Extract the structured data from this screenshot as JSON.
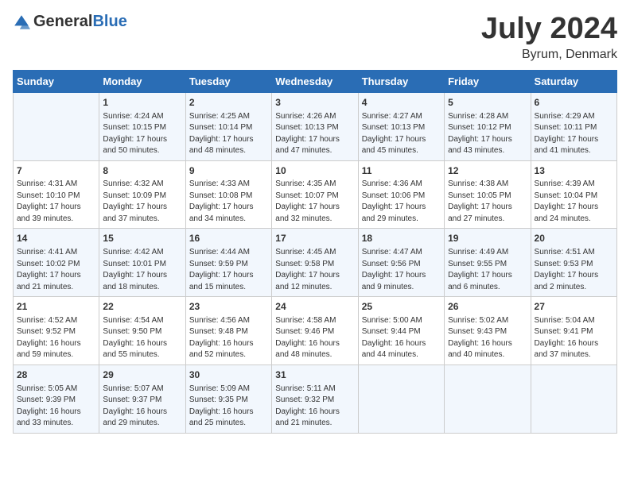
{
  "header": {
    "logo_general": "General",
    "logo_blue": "Blue",
    "month_title": "July 2024",
    "location": "Byrum, Denmark"
  },
  "days_of_week": [
    "Sunday",
    "Monday",
    "Tuesday",
    "Wednesday",
    "Thursday",
    "Friday",
    "Saturday"
  ],
  "weeks": [
    [
      {
        "day": "",
        "info": ""
      },
      {
        "day": "1",
        "info": "Sunrise: 4:24 AM\nSunset: 10:15 PM\nDaylight: 17 hours\nand 50 minutes."
      },
      {
        "day": "2",
        "info": "Sunrise: 4:25 AM\nSunset: 10:14 PM\nDaylight: 17 hours\nand 48 minutes."
      },
      {
        "day": "3",
        "info": "Sunrise: 4:26 AM\nSunset: 10:13 PM\nDaylight: 17 hours\nand 47 minutes."
      },
      {
        "day": "4",
        "info": "Sunrise: 4:27 AM\nSunset: 10:13 PM\nDaylight: 17 hours\nand 45 minutes."
      },
      {
        "day": "5",
        "info": "Sunrise: 4:28 AM\nSunset: 10:12 PM\nDaylight: 17 hours\nand 43 minutes."
      },
      {
        "day": "6",
        "info": "Sunrise: 4:29 AM\nSunset: 10:11 PM\nDaylight: 17 hours\nand 41 minutes."
      }
    ],
    [
      {
        "day": "7",
        "info": "Sunrise: 4:31 AM\nSunset: 10:10 PM\nDaylight: 17 hours\nand 39 minutes."
      },
      {
        "day": "8",
        "info": "Sunrise: 4:32 AM\nSunset: 10:09 PM\nDaylight: 17 hours\nand 37 minutes."
      },
      {
        "day": "9",
        "info": "Sunrise: 4:33 AM\nSunset: 10:08 PM\nDaylight: 17 hours\nand 34 minutes."
      },
      {
        "day": "10",
        "info": "Sunrise: 4:35 AM\nSunset: 10:07 PM\nDaylight: 17 hours\nand 32 minutes."
      },
      {
        "day": "11",
        "info": "Sunrise: 4:36 AM\nSunset: 10:06 PM\nDaylight: 17 hours\nand 29 minutes."
      },
      {
        "day": "12",
        "info": "Sunrise: 4:38 AM\nSunset: 10:05 PM\nDaylight: 17 hours\nand 27 minutes."
      },
      {
        "day": "13",
        "info": "Sunrise: 4:39 AM\nSunset: 10:04 PM\nDaylight: 17 hours\nand 24 minutes."
      }
    ],
    [
      {
        "day": "14",
        "info": "Sunrise: 4:41 AM\nSunset: 10:02 PM\nDaylight: 17 hours\nand 21 minutes."
      },
      {
        "day": "15",
        "info": "Sunrise: 4:42 AM\nSunset: 10:01 PM\nDaylight: 17 hours\nand 18 minutes."
      },
      {
        "day": "16",
        "info": "Sunrise: 4:44 AM\nSunset: 9:59 PM\nDaylight: 17 hours\nand 15 minutes."
      },
      {
        "day": "17",
        "info": "Sunrise: 4:45 AM\nSunset: 9:58 PM\nDaylight: 17 hours\nand 12 minutes."
      },
      {
        "day": "18",
        "info": "Sunrise: 4:47 AM\nSunset: 9:56 PM\nDaylight: 17 hours\nand 9 minutes."
      },
      {
        "day": "19",
        "info": "Sunrise: 4:49 AM\nSunset: 9:55 PM\nDaylight: 17 hours\nand 6 minutes."
      },
      {
        "day": "20",
        "info": "Sunrise: 4:51 AM\nSunset: 9:53 PM\nDaylight: 17 hours\nand 2 minutes."
      }
    ],
    [
      {
        "day": "21",
        "info": "Sunrise: 4:52 AM\nSunset: 9:52 PM\nDaylight: 16 hours\nand 59 minutes."
      },
      {
        "day": "22",
        "info": "Sunrise: 4:54 AM\nSunset: 9:50 PM\nDaylight: 16 hours\nand 55 minutes."
      },
      {
        "day": "23",
        "info": "Sunrise: 4:56 AM\nSunset: 9:48 PM\nDaylight: 16 hours\nand 52 minutes."
      },
      {
        "day": "24",
        "info": "Sunrise: 4:58 AM\nSunset: 9:46 PM\nDaylight: 16 hours\nand 48 minutes."
      },
      {
        "day": "25",
        "info": "Sunrise: 5:00 AM\nSunset: 9:44 PM\nDaylight: 16 hours\nand 44 minutes."
      },
      {
        "day": "26",
        "info": "Sunrise: 5:02 AM\nSunset: 9:43 PM\nDaylight: 16 hours\nand 40 minutes."
      },
      {
        "day": "27",
        "info": "Sunrise: 5:04 AM\nSunset: 9:41 PM\nDaylight: 16 hours\nand 37 minutes."
      }
    ],
    [
      {
        "day": "28",
        "info": "Sunrise: 5:05 AM\nSunset: 9:39 PM\nDaylight: 16 hours\nand 33 minutes."
      },
      {
        "day": "29",
        "info": "Sunrise: 5:07 AM\nSunset: 9:37 PM\nDaylight: 16 hours\nand 29 minutes."
      },
      {
        "day": "30",
        "info": "Sunrise: 5:09 AM\nSunset: 9:35 PM\nDaylight: 16 hours\nand 25 minutes."
      },
      {
        "day": "31",
        "info": "Sunrise: 5:11 AM\nSunset: 9:32 PM\nDaylight: 16 hours\nand 21 minutes."
      },
      {
        "day": "",
        "info": ""
      },
      {
        "day": "",
        "info": ""
      },
      {
        "day": "",
        "info": ""
      }
    ]
  ]
}
